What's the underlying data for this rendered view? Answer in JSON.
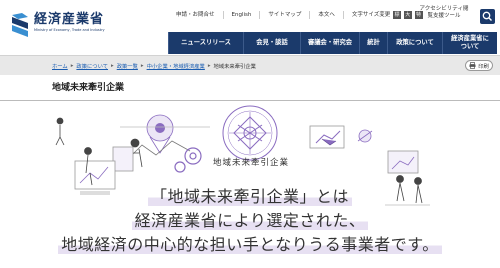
{
  "header": {
    "logo_text": "経済産業省",
    "logo_subtext": "Ministry of Economy, Trade and Industry",
    "utility_links": [
      "申請・お問合せ",
      "English",
      "サイトマップ",
      "本文へ"
    ],
    "font_size_label": "文字サイズ変更",
    "font_sizes": [
      "標",
      "大",
      "特"
    ],
    "accessibility_label": "アクセシビリティ閲覧支援ツール",
    "search_icon": "search-icon"
  },
  "nav": {
    "items": [
      "ニュースリリース",
      "会見・談話",
      "審議会・研究会",
      "統計",
      "政策について",
      "経済産業省について"
    ]
  },
  "breadcrumb": {
    "items": [
      "ホーム",
      "政策について",
      "政策一覧",
      "中小企業・地域経済産業",
      "地域未来牽引企業"
    ]
  },
  "print_label": "印刷",
  "page_title": "地域未来牽引企業",
  "hero": {
    "emblem_label": "地域未来牽引企業",
    "headline_1": "「地域未来牽引企業」とは",
    "headline_2": "経済産業省により選定された、",
    "headline_3": "地域経済の中心的な担い手となりうる事業者です。",
    "accent_color": "#8a6cc0",
    "nav_color": "#1b3a6b"
  }
}
